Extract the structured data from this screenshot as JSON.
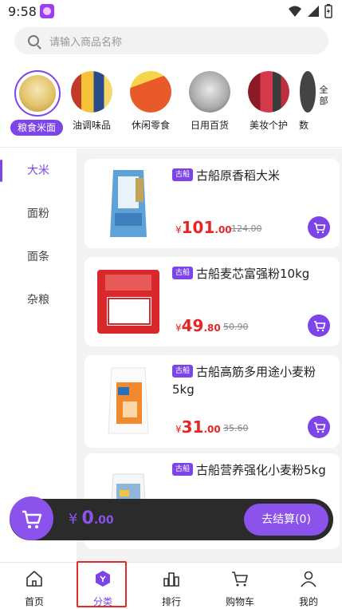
{
  "status_bar": {
    "time": "9:58"
  },
  "search": {
    "placeholder": "请输入商品名称"
  },
  "categories": [
    {
      "label": "粮食米面",
      "active": true,
      "icon": "rice-bag-icon",
      "color": "#e9d08a"
    },
    {
      "label": "油调味品",
      "active": false,
      "icon": "oil-bottles-icon",
      "color": "#f1c24a"
    },
    {
      "label": "休闲零食",
      "active": false,
      "icon": "snack-pack-icon",
      "color": "#e85a2a"
    },
    {
      "label": "日用百货",
      "active": false,
      "icon": "rice-cooker-icon",
      "color": "#b9b9b9"
    },
    {
      "label": "美妆个护",
      "active": false,
      "icon": "cosmetics-icon",
      "color": "#c0303c"
    },
    {
      "label": "数",
      "active": false,
      "icon": "digital-icon",
      "color": "#555555"
    }
  ],
  "more_categories": "全部",
  "sidebar": {
    "items": [
      {
        "label": "大米",
        "active": true
      },
      {
        "label": "面粉",
        "active": false
      },
      {
        "label": "面条",
        "active": false
      },
      {
        "label": "杂粮",
        "active": false
      }
    ]
  },
  "products": [
    {
      "tag": "古船",
      "name": "古船原香稻大米",
      "price_symbol": "¥",
      "price_int": "101",
      "price_dec": ".00",
      "old_price": "124.00",
      "image": "rice-bag-image",
      "img_color": "#5a9fd6"
    },
    {
      "tag": "古船",
      "name": "古船麦芯富强粉10kg",
      "price_symbol": "¥",
      "price_int": "49",
      "price_dec": ".80",
      "old_price": "50.90",
      "image": "flour-red-bag-image",
      "img_color": "#d8282b"
    },
    {
      "tag": "古船",
      "name": "古船高筋多用途小麦粉5kg",
      "price_symbol": "¥",
      "price_int": "31",
      "price_dec": ".00",
      "old_price": "35.60",
      "image": "flour-orange-bag-image",
      "img_color": "#f08a2c"
    },
    {
      "tag": "古船",
      "name": "古船营养强化小麦粉5kg",
      "price_symbol": "¥",
      "price_int": "",
      "price_dec": "",
      "old_price": "",
      "image": "flour-white-bag-image",
      "img_color": "#8fb6d9"
    }
  ],
  "cart": {
    "symbol": "¥",
    "total_int": "0",
    "total_dec": ".00",
    "checkout_label": "去结算(0)"
  },
  "tabs": [
    {
      "label": "首页",
      "icon": "home-icon",
      "active": false
    },
    {
      "label": "分类",
      "icon": "category-icon",
      "active": true
    },
    {
      "label": "排行",
      "icon": "ranking-icon",
      "active": false
    },
    {
      "label": "购物车",
      "icon": "cart-icon",
      "active": false
    },
    {
      "label": "我的",
      "icon": "profile-icon",
      "active": false
    }
  ],
  "colors": {
    "accent": "#7d45e8",
    "price": "#e62525",
    "highlight": "#e02b2b"
  }
}
